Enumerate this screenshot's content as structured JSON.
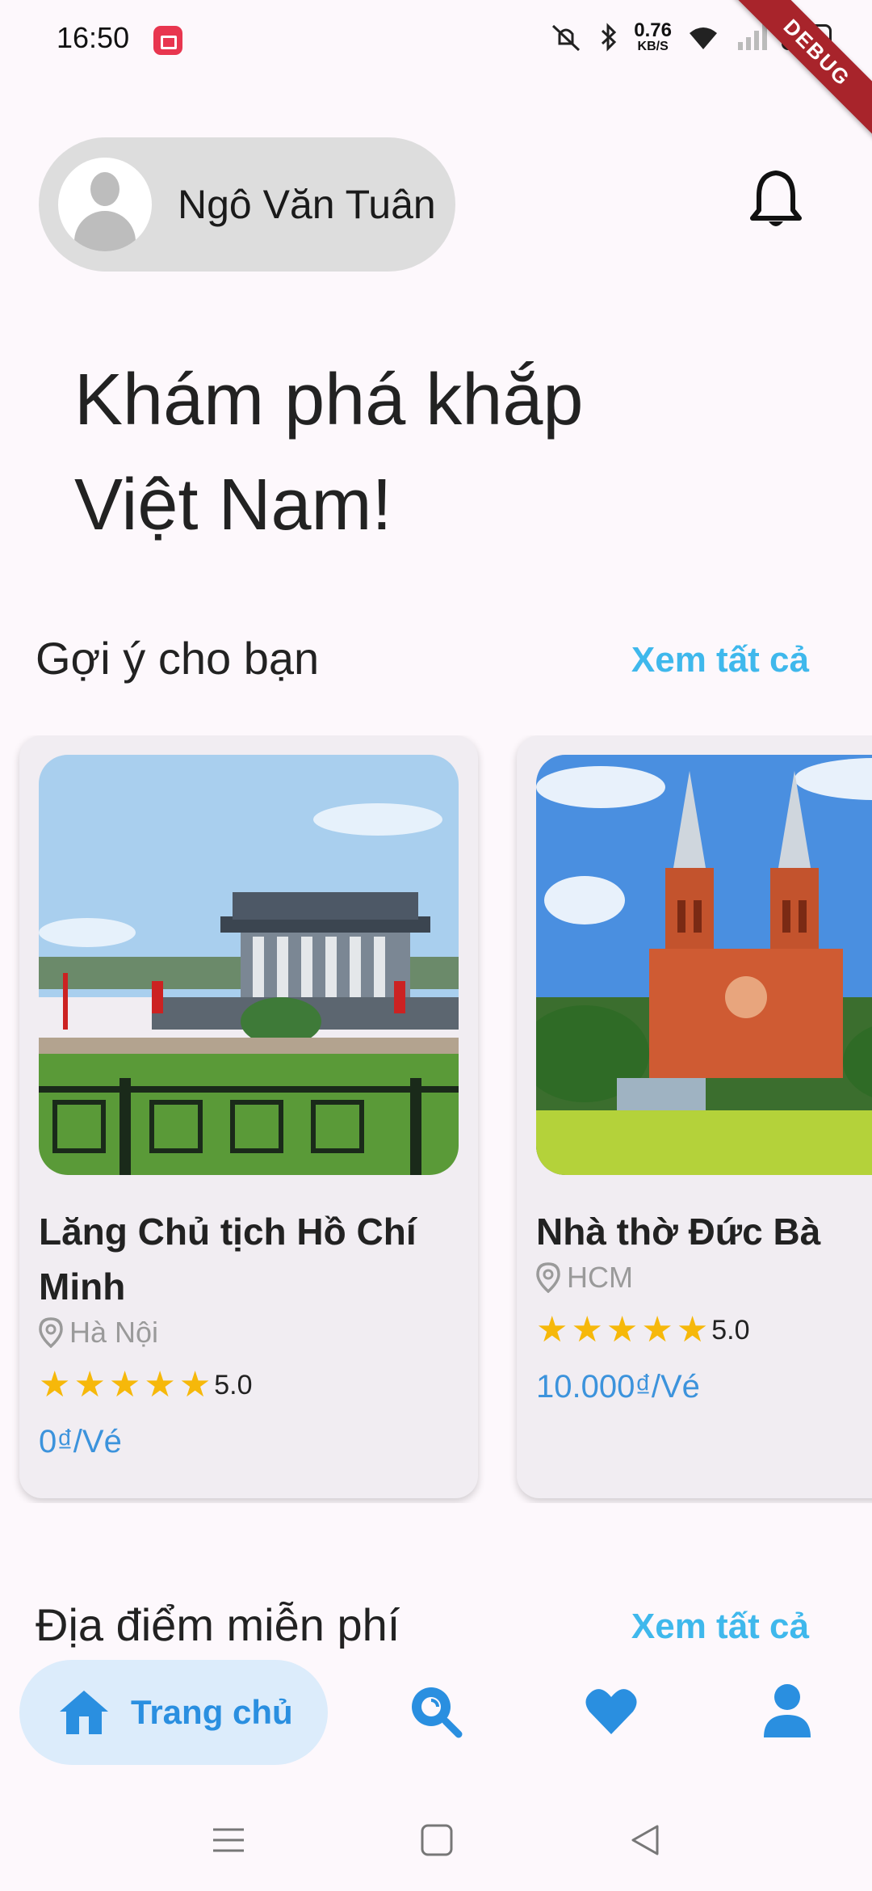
{
  "status_bar": {
    "time": "16:50",
    "net_speed_value": "0.76",
    "net_speed_unit": "KB/S",
    "battery": "62",
    "icons": [
      "screen-record-icon",
      "mute-icon",
      "bluetooth-icon",
      "wifi-icon",
      "signal-icon",
      "battery-icon",
      "charging-icon"
    ]
  },
  "debug_banner": "DEBUG",
  "header": {
    "user_name": "Ngô Văn Tuân",
    "notification_icon": "bell-icon"
  },
  "headline": "Khám phá khắp Việt Nam!",
  "sections": {
    "suggested": {
      "title": "Gợi ý cho bạn",
      "see_all": "Xem tất cả"
    },
    "free_places": {
      "title": "Địa điểm miễn phí",
      "see_all": "Xem tất cả"
    }
  },
  "cards": [
    {
      "title": "Lăng Chủ tịch Hồ Chí Minh",
      "location": "Hà Nội",
      "rating": "5.0",
      "stars": 5,
      "price": "0₫/Vé"
    },
    {
      "title": "Nhà thờ Đức Bà",
      "location": "HCM",
      "rating": "5.0",
      "stars": 5,
      "price": "10.000₫/Vé"
    }
  ],
  "bottom_nav": {
    "home_label": "Trang chủ",
    "items": [
      "home-icon",
      "search-icon",
      "heart-icon",
      "person-icon"
    ],
    "active": "home"
  },
  "colors": {
    "accent": "#2a8fe0",
    "see_all": "#3fb8ec",
    "star": "#f6b80a",
    "price": "#3c93dc"
  }
}
